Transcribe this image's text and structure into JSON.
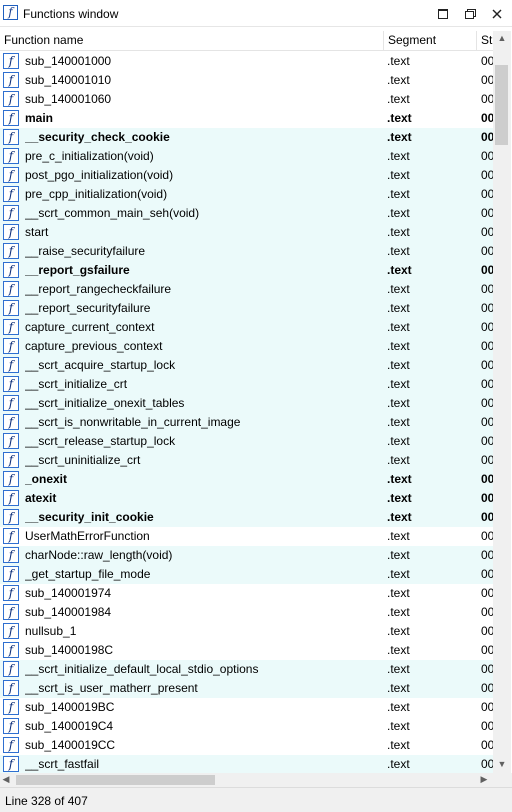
{
  "window": {
    "title": "Functions window"
  },
  "columns": {
    "name": "Function name",
    "segment": "Segment",
    "start": "St"
  },
  "status": "Line 328 of 407",
  "icons": {
    "function": "f"
  },
  "colors": {
    "highlight_row": "#ebfafa",
    "icon_border": "#2f6fd0"
  },
  "rows": [
    {
      "name": "sub_140001000",
      "segment": ".text",
      "start": "00",
      "bold": false,
      "hl": false
    },
    {
      "name": "sub_140001010",
      "segment": ".text",
      "start": "00",
      "bold": false,
      "hl": false
    },
    {
      "name": "sub_140001060",
      "segment": ".text",
      "start": "00",
      "bold": false,
      "hl": false
    },
    {
      "name": "main",
      "segment": ".text",
      "start": "00",
      "bold": true,
      "hl": false
    },
    {
      "name": "__security_check_cookie",
      "segment": ".text",
      "start": "00",
      "bold": true,
      "hl": true
    },
    {
      "name": "pre_c_initialization(void)",
      "segment": ".text",
      "start": "00",
      "bold": false,
      "hl": true
    },
    {
      "name": "post_pgo_initialization(void)",
      "segment": ".text",
      "start": "00",
      "bold": false,
      "hl": true
    },
    {
      "name": "pre_cpp_initialization(void)",
      "segment": ".text",
      "start": "00",
      "bold": false,
      "hl": true
    },
    {
      "name": "__scrt_common_main_seh(void)",
      "segment": ".text",
      "start": "00",
      "bold": false,
      "hl": true
    },
    {
      "name": "start",
      "segment": ".text",
      "start": "00",
      "bold": false,
      "hl": true
    },
    {
      "name": "__raise_securityfailure",
      "segment": ".text",
      "start": "00",
      "bold": false,
      "hl": true
    },
    {
      "name": "__report_gsfailure",
      "segment": ".text",
      "start": "00",
      "bold": true,
      "hl": true
    },
    {
      "name": "__report_rangecheckfailure",
      "segment": ".text",
      "start": "00",
      "bold": false,
      "hl": true
    },
    {
      "name": "__report_securityfailure",
      "segment": ".text",
      "start": "00",
      "bold": false,
      "hl": true
    },
    {
      "name": "capture_current_context",
      "segment": ".text",
      "start": "00",
      "bold": false,
      "hl": true
    },
    {
      "name": "capture_previous_context",
      "segment": ".text",
      "start": "00",
      "bold": false,
      "hl": true
    },
    {
      "name": "__scrt_acquire_startup_lock",
      "segment": ".text",
      "start": "00",
      "bold": false,
      "hl": true
    },
    {
      "name": "__scrt_initialize_crt",
      "segment": ".text",
      "start": "00",
      "bold": false,
      "hl": true
    },
    {
      "name": "__scrt_initialize_onexit_tables",
      "segment": ".text",
      "start": "00",
      "bold": false,
      "hl": true
    },
    {
      "name": "__scrt_is_nonwritable_in_current_image",
      "segment": ".text",
      "start": "00",
      "bold": false,
      "hl": true
    },
    {
      "name": "__scrt_release_startup_lock",
      "segment": ".text",
      "start": "00",
      "bold": false,
      "hl": true
    },
    {
      "name": "__scrt_uninitialize_crt",
      "segment": ".text",
      "start": "00",
      "bold": false,
      "hl": true
    },
    {
      "name": "_onexit",
      "segment": ".text",
      "start": "00",
      "bold": true,
      "hl": true
    },
    {
      "name": "atexit",
      "segment": ".text",
      "start": "00",
      "bold": true,
      "hl": true
    },
    {
      "name": "__security_init_cookie",
      "segment": ".text",
      "start": "00",
      "bold": true,
      "hl": true
    },
    {
      "name": "UserMathErrorFunction",
      "segment": ".text",
      "start": "00",
      "bold": false,
      "hl": false
    },
    {
      "name": "charNode::raw_length(void)",
      "segment": ".text",
      "start": "00",
      "bold": false,
      "hl": true
    },
    {
      "name": "_get_startup_file_mode",
      "segment": ".text",
      "start": "00",
      "bold": false,
      "hl": true
    },
    {
      "name": "sub_140001974",
      "segment": ".text",
      "start": "00",
      "bold": false,
      "hl": false
    },
    {
      "name": "sub_140001984",
      "segment": ".text",
      "start": "00",
      "bold": false,
      "hl": false
    },
    {
      "name": "nullsub_1",
      "segment": ".text",
      "start": "00",
      "bold": false,
      "hl": false
    },
    {
      "name": "sub_14000198C",
      "segment": ".text",
      "start": "00",
      "bold": false,
      "hl": false
    },
    {
      "name": "__scrt_initialize_default_local_stdio_options",
      "segment": ".text",
      "start": "00",
      "bold": false,
      "hl": true
    },
    {
      "name": "__scrt_is_user_matherr_present",
      "segment": ".text",
      "start": "00",
      "bold": false,
      "hl": true
    },
    {
      "name": "sub_1400019BC",
      "segment": ".text",
      "start": "00",
      "bold": false,
      "hl": false
    },
    {
      "name": "sub_1400019C4",
      "segment": ".text",
      "start": "00",
      "bold": false,
      "hl": false
    },
    {
      "name": "sub_1400019CC",
      "segment": ".text",
      "start": "00",
      "bold": false,
      "hl": false
    },
    {
      "name": "__scrt_fastfail",
      "segment": ".text",
      "start": "00",
      "bold": false,
      "hl": true
    }
  ]
}
